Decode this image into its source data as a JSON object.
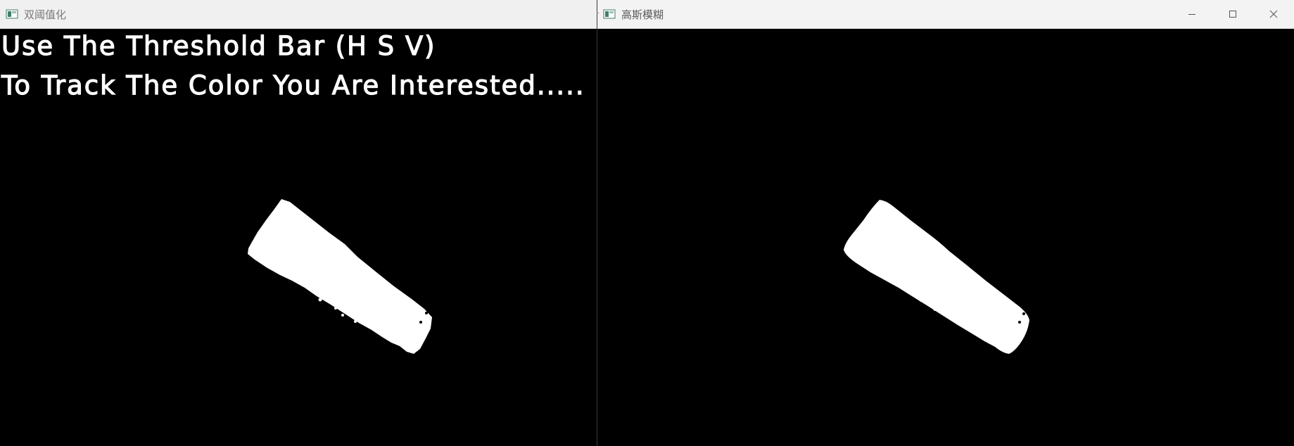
{
  "windows": {
    "left": {
      "title": "双阈值化",
      "overlay_text": [
        "Use The Threshold Bar (H S V)",
        "To Track The Color You Are Interested....."
      ],
      "icon": "opencv-window-icon"
    },
    "right": {
      "title": "高斯模糊",
      "icon": "opencv-window-icon",
      "controls": {
        "minimize": "minimize-icon",
        "maximize": "maximize-icon",
        "close": "close-icon"
      }
    }
  },
  "colors": {
    "canvas_background": "#000000",
    "mask_foreground": "#ffffff",
    "titlebar": "#f3f3f3",
    "title_text": "#7a7a7a"
  }
}
